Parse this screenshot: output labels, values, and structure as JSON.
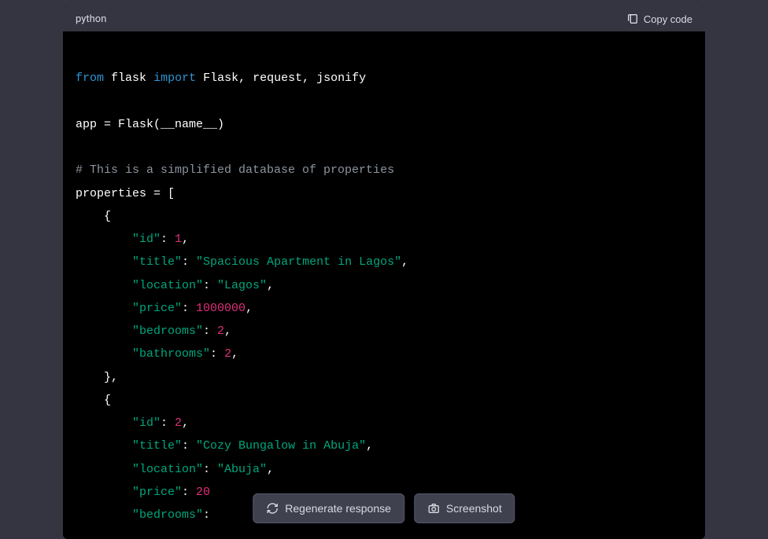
{
  "header": {
    "language": "python",
    "copy_label": "Copy code"
  },
  "code": {
    "line1": {
      "from": "from",
      "module": "flask",
      "import": "import",
      "names": "Flask, request, jsonify"
    },
    "line2": {
      "app_eq": "app = Flask(__name__)"
    },
    "comment": "# This is a simplified database of properties",
    "prop_decl": "properties = [",
    "brace_open": "{",
    "brace_close": "},",
    "prop1": {
      "id_key": "\"id\"",
      "id_val": "1",
      "title_key": "\"title\"",
      "title_val": "\"Spacious Apartment in Lagos\"",
      "location_key": "\"location\"",
      "location_val": "\"Lagos\"",
      "price_key": "\"price\"",
      "price_val": "1000000",
      "bedrooms_key": "\"bedrooms\"",
      "bedrooms_val": "2",
      "bathrooms_key": "\"bathrooms\"",
      "bathrooms_val": "2"
    },
    "prop2": {
      "id_key": "\"id\"",
      "id_val": "2",
      "title_key": "\"title\"",
      "title_val": "\"Cozy Bungalow in Abuja\"",
      "location_key": "\"location\"",
      "location_val": "\"Abuja\"",
      "price_key": "\"price\"",
      "price_val": "20",
      "bedrooms_key": "\"bedrooms\"",
      "bedrooms_colon": ":"
    },
    "colon_comma": ": ",
    "comma": ","
  },
  "buttons": {
    "regenerate": "Regenerate response",
    "screenshot": "Screenshot"
  }
}
